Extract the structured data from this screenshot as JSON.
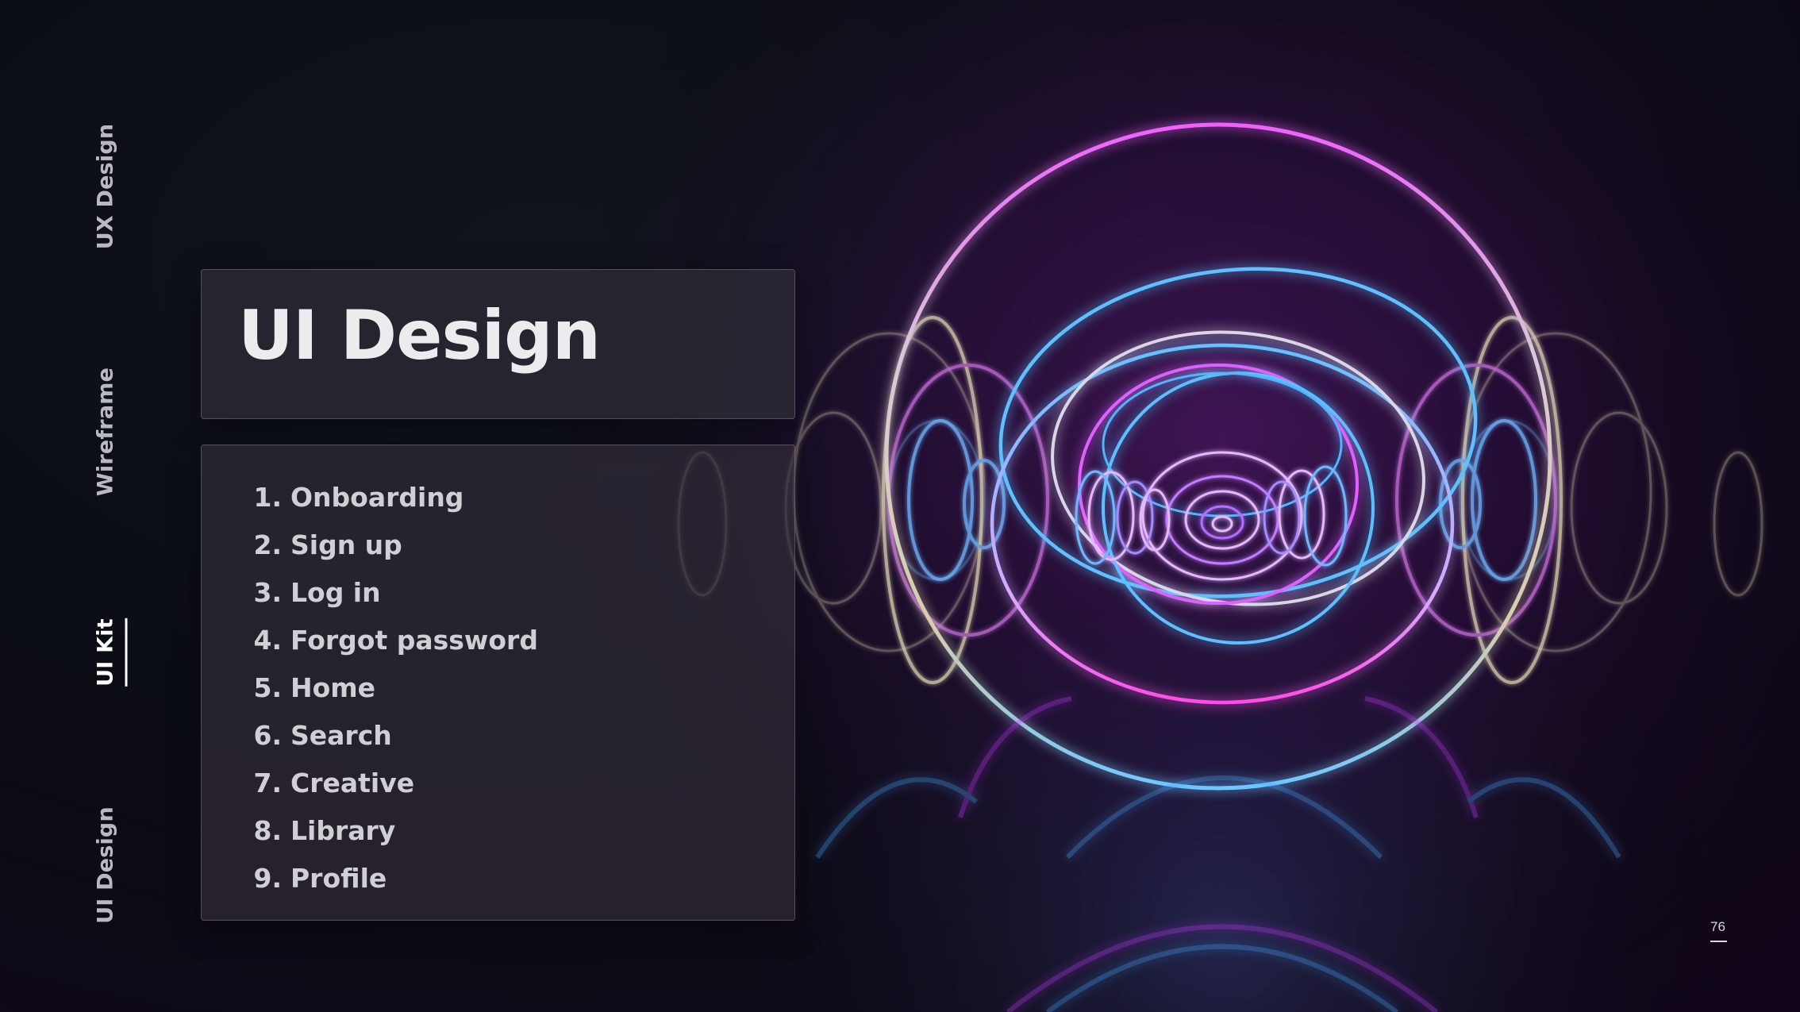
{
  "nav": {
    "items": [
      {
        "label": "UX Design",
        "active": false
      },
      {
        "label": "Wireframe",
        "active": false
      },
      {
        "label": "UI Kit",
        "active": true
      },
      {
        "label": "UI Design",
        "active": false
      }
    ]
  },
  "header": {
    "title": "UI Design"
  },
  "screens": [
    {
      "number": "1.",
      "label": "Onboarding"
    },
    {
      "number": "2.",
      "label": "Sign up"
    },
    {
      "number": "3.",
      "label": "Log in"
    },
    {
      "number": "4.",
      "label": "Forgot password"
    },
    {
      "number": "5.",
      "label": "Home"
    },
    {
      "number": "6.",
      "label": "Search"
    },
    {
      "number": "7.",
      "label": "Creative"
    },
    {
      "number": "8.",
      "label": "Library"
    },
    {
      "number": "9.",
      "label": "Profile"
    }
  ],
  "footer": {
    "page_number": "76"
  },
  "colors": {
    "neon_magenta": "#e040ff",
    "neon_blue": "#3fb4ff",
    "neon_pale": "#e8e0c8",
    "card_bg": "#302d38"
  }
}
